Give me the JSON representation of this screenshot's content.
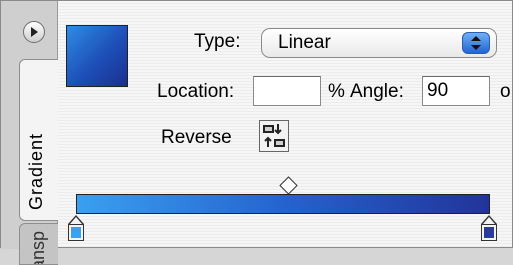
{
  "panel": {
    "tabs": [
      {
        "label": "Gradient",
        "active": true
      },
      {
        "label": "ransp",
        "active": false
      }
    ],
    "menu_icon": "circle-right-arrow-icon"
  },
  "swatch": {
    "color_start": "#2f8ce3",
    "color_end": "#1b2f8e"
  },
  "type": {
    "label": "Type:",
    "value": "Linear",
    "options_visible": [
      "Linear"
    ]
  },
  "location": {
    "label": "Location:",
    "value": "",
    "unit": "%"
  },
  "angle": {
    "label": "Angle:",
    "value": "90",
    "unit": "o"
  },
  "reverse": {
    "label": "Reverse",
    "icon": "reverse-gradient-icon"
  },
  "gradient_bar": {
    "start_color": "#3aa0f0",
    "end_color": "#22349a",
    "stops": [
      {
        "color": "#3aa0f0",
        "location_percent": 0
      },
      {
        "color": "#2a3b9c",
        "location_percent": 100
      }
    ],
    "midpoint_percent": 50
  }
}
